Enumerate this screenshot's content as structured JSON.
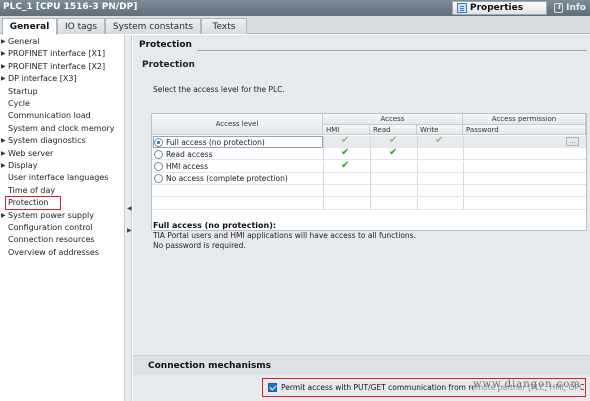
{
  "window": {
    "title": "PLC_1 [CPU 1516-3 PN/DP]"
  },
  "toolbar": {
    "properties_label": "Properties",
    "info_label": "Info"
  },
  "tabs": [
    {
      "label": "General"
    },
    {
      "label": "IO tags"
    },
    {
      "label": "System constants"
    },
    {
      "label": "Texts"
    }
  ],
  "nav": {
    "items": [
      {
        "label": "General",
        "expandable": true
      },
      {
        "label": "PROFINET interface [X1]",
        "expandable": true
      },
      {
        "label": "PROFINET interface [X2]",
        "expandable": true
      },
      {
        "label": "DP interface [X3]",
        "expandable": true
      },
      {
        "label": "Startup",
        "expandable": false
      },
      {
        "label": "Cycle",
        "expandable": false
      },
      {
        "label": "Communication load",
        "expandable": false
      },
      {
        "label": "System and clock memory",
        "expandable": false
      },
      {
        "label": "System diagnostics",
        "expandable": true
      },
      {
        "label": "Web server",
        "expandable": true
      },
      {
        "label": "Display",
        "expandable": true
      },
      {
        "label": "User interface languages",
        "expandable": false
      },
      {
        "label": "Time of day",
        "expandable": false
      },
      {
        "label": "Protection",
        "expandable": false,
        "selected": true
      },
      {
        "label": "System power supply",
        "expandable": true
      },
      {
        "label": "Configuration control",
        "expandable": false
      },
      {
        "label": "Connection resources",
        "expandable": false
      },
      {
        "label": "Overview of addresses",
        "expandable": false
      }
    ]
  },
  "content": {
    "section_title": "Protection",
    "panel_title": "Protection",
    "description": "Select the access level for the PLC.",
    "table": {
      "headers": {
        "access_level": "Access level",
        "access": "Access",
        "access_permission": "Access permission",
        "hmi": "HMI",
        "read": "Read",
        "write": "Write",
        "password": "Password"
      },
      "rows": [
        {
          "label": "Full access (no protection)",
          "selected": true,
          "hmi": true,
          "read": true,
          "write": true
        },
        {
          "label": "Read access",
          "selected": false,
          "hmi": true,
          "read": true,
          "write": false
        },
        {
          "label": "HMI access",
          "selected": false,
          "hmi": true,
          "read": false,
          "write": false
        },
        {
          "label": "No access (complete protection)",
          "selected": false,
          "hmi": false,
          "read": false,
          "write": false
        }
      ],
      "check_glyph": "✔",
      "password_button": "..."
    },
    "info_heading": "Full access (no protection):",
    "info_line1": "TIA Portal users and HMI applications will have access to all functions.",
    "info_line2": "No password is required."
  },
  "connection": {
    "title": "Connection mechanisms",
    "permit_label": "Permit access with PUT/GET communication from remote partner (PLC, HMI, OPC, ...)",
    "permit_checked": true,
    "watermark": "www.diangon.com"
  },
  "colors": {
    "highlight_outline": "#d32027",
    "check_green": "#2f9a2c",
    "radio_blue": "#1f6fc4"
  }
}
